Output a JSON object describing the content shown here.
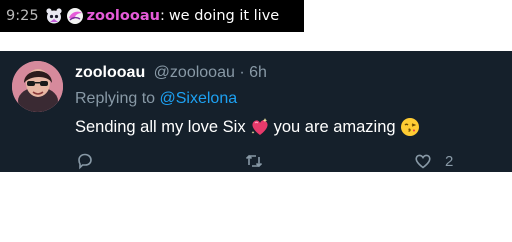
{
  "chat": {
    "time": "9:25",
    "username": "zoolooau",
    "colon": ":",
    "message": "we doing it live",
    "user_color": "#e65bd9",
    "badges": [
      "broadcaster-mascot-badge-icon",
      "wing-badge-icon"
    ]
  },
  "tweet": {
    "display_name": "zoolooau",
    "handle": "@zoolooau",
    "separator": "·",
    "age": "6h",
    "replying_prefix": "Replying to",
    "replying_to": "@Sixelona",
    "text_part1": "Sending all my love Six",
    "text_part2": "you are amazing",
    "emojis": [
      "sparkling-heart-icon",
      "face-blowing-kiss-icon"
    ],
    "like_count": "2",
    "actions": [
      "reply-icon",
      "retweet-icon",
      "like-icon"
    ]
  },
  "colors": {
    "tweet_background": "#15202b",
    "muted_text": "#8899a6",
    "link": "#1da1f2",
    "chat_background": "#000000"
  }
}
